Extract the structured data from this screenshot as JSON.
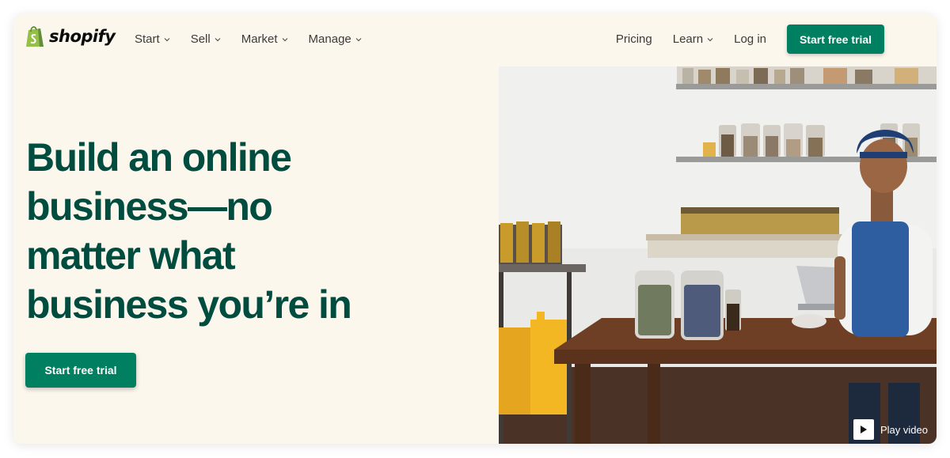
{
  "brand": {
    "name": "shopify",
    "color": "#008060",
    "bag_color": "#95bf47",
    "heading_color": "#004c3f"
  },
  "nav": {
    "menu": [
      {
        "label": "Start",
        "icon": "chevron-down-icon"
      },
      {
        "label": "Sell",
        "icon": "chevron-down-icon"
      },
      {
        "label": "Market",
        "icon": "chevron-down-icon"
      },
      {
        "label": "Manage",
        "icon": "chevron-down-icon"
      }
    ],
    "pricing": "Pricing",
    "learn": "Learn",
    "login": "Log in",
    "cta": "Start free trial"
  },
  "hero": {
    "headline_lines": [
      "Build an online",
      "business—no",
      "matter what",
      "business you’re in"
    ],
    "cta": "Start free trial",
    "play_label": "Play video",
    "play_icon": "play-icon",
    "background": "#fbf7ed"
  }
}
